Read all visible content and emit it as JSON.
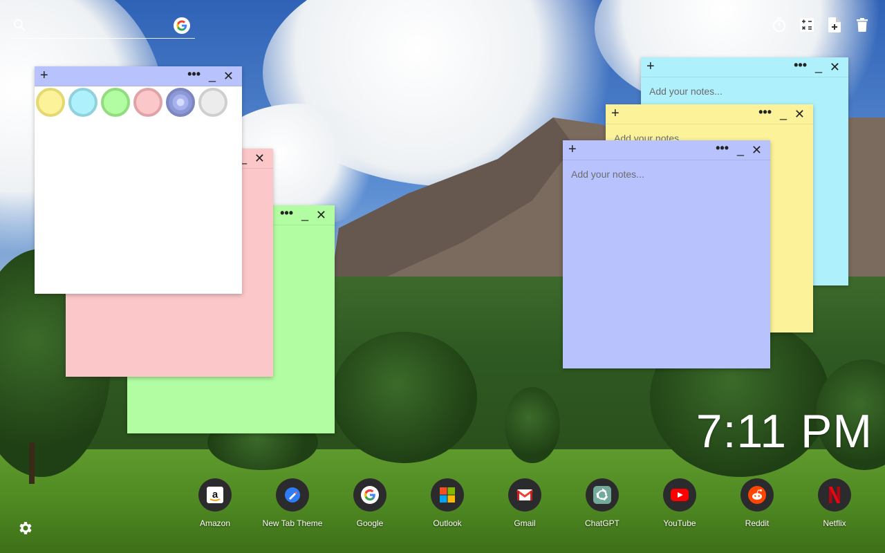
{
  "search": {
    "placeholder": ""
  },
  "toolbar": {
    "icons": [
      "timer-icon",
      "calculator-icon",
      "add-note-icon",
      "trash-icon"
    ]
  },
  "notes": {
    "placeholder": "Add your notes...",
    "colors": {
      "yellow": "#fbf29a",
      "cyan": "#aef0fb",
      "green": "#b2fda1",
      "pink": "#fbc7c8",
      "indigo": "#b8c3fd",
      "white": "#ffffff",
      "gray": "#e9e9e9"
    },
    "palette_options": [
      "yellow",
      "cyan",
      "green",
      "pink",
      "indigo",
      "gray"
    ],
    "palette_selected": "indigo",
    "header_symbols": {
      "add": "+",
      "menu": "•••",
      "minimize": "_",
      "close": "✕"
    }
  },
  "clock": {
    "time": "7:11 PM"
  },
  "shortcuts": [
    {
      "label": "Amazon",
      "icon": "amazon-icon"
    },
    {
      "label": "New Tab Theme",
      "icon": "new-tab-theme-icon"
    },
    {
      "label": "Google",
      "icon": "google-icon"
    },
    {
      "label": "Outlook",
      "icon": "outlook-icon"
    },
    {
      "label": "Gmail",
      "icon": "gmail-icon"
    },
    {
      "label": "ChatGPT",
      "icon": "chatgpt-icon"
    },
    {
      "label": "YouTube",
      "icon": "youtube-icon"
    },
    {
      "label": "Reddit",
      "icon": "reddit-icon"
    },
    {
      "label": "Netflix",
      "icon": "netflix-icon"
    }
  ]
}
